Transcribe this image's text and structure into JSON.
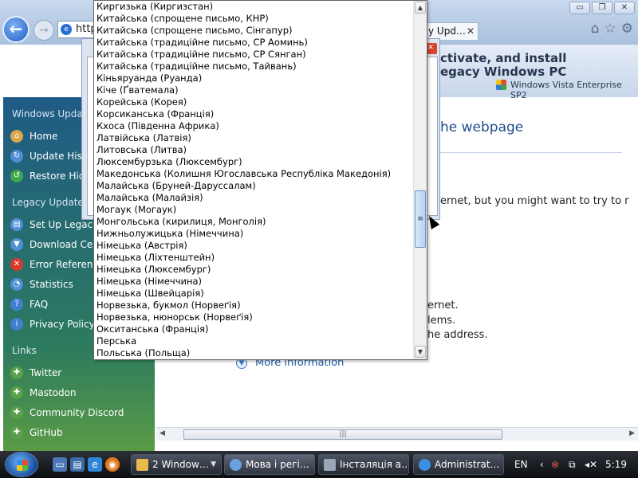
{
  "browser": {
    "address_prefix": "http",
    "tab_label": "y Upd…",
    "tab_close": "✕",
    "window_buttons": [
      "▭",
      "❐",
      "✕"
    ],
    "toolbar_icons": [
      "⌂",
      "☆",
      "⚙"
    ]
  },
  "page": {
    "banner_title_lines": [
      "ctivate, and install",
      "egacy Windows PC"
    ],
    "banner_subtitle": "Windows Vista Enterprise SP2",
    "heading": "he webpage",
    "body_line1": "ernet, but you might want to try to r",
    "body_lines": [
      "ernet.",
      "lems.",
      "he address."
    ],
    "more_info": "More information",
    "sidebar": {
      "section1": "Windows Updat",
      "items1": [
        {
          "label": "Home",
          "color": "#d9a64a"
        },
        {
          "label": "Update Hist",
          "color": "#4f8fd6"
        },
        {
          "label": "Restore Hid",
          "color": "#3ea84a"
        }
      ],
      "section2": "Legacy Update",
      "items2": [
        {
          "label": "Set Up Legacy",
          "color": "#4f8fd6"
        },
        {
          "label": "Download Cent",
          "color": "#4f8fd6"
        },
        {
          "label": "Error Reference",
          "color": "#d93a2c"
        },
        {
          "label": "Statistics",
          "color": "#4f8fd6"
        },
        {
          "label": "FAQ",
          "color": "#3e7fd0"
        },
        {
          "label": "Privacy Policy",
          "color": "#3e7fd0"
        }
      ],
      "section3": "Links",
      "items3": [
        {
          "label": "Twitter",
          "color": "#5aa04a"
        },
        {
          "label": "Mastodon",
          "color": "#5aa04a"
        },
        {
          "label": "Community Discord",
          "color": "#5aa04a"
        },
        {
          "label": "GitHub",
          "color": "#5aa04a"
        }
      ]
    }
  },
  "dropdown": {
    "items": [
      "Киргизька (Киргизстан)",
      "Китайська (спрощене письмо, КНР)",
      "Китайська (спрощене письмо, Сінгапур)",
      "Китайська (традиційне письмо, СР Аоминь)",
      "Китайська (традиційне письмо, СР Сянган)",
      "Китайська (традиційне письмо, Тайвань)",
      "Кіньяруанда (Руанда)",
      "Кіче (Ґватемала)",
      "Корейська (Корея)",
      "Корсиканська (Франція)",
      "Кхоса (Південна Африка)",
      "Латвійська (Латвія)",
      "Литовська (Литва)",
      "Люксембурзька (Люксембург)",
      "Македонська (Колишня Югославська Республіка Македонія)",
      "Малайська (Бруней-Даруссалам)",
      "Малайська (Малайзія)",
      "Могаук (Могаук)",
      "Монгольська (кирилиця, Монголія)",
      "Нижньолужицька (Німеччина)",
      "Німецька (Австрія)",
      "Німецька (Ліхтенштейн)",
      "Німецька (Люксембург)",
      "Німецька (Німеччина)",
      "Німецька (Швейцарія)",
      "Норвезька, букмол (Норвеґія)",
      "Норвезька, нюнорськ (Норвеґія)",
      "Окситанська (Франція)",
      "Перська",
      "Польська (Польща)"
    ]
  },
  "taskbar": {
    "tasks": [
      {
        "label": "2 Window…",
        "color": "#e9b949"
      },
      {
        "label": "Мова і регі…",
        "color": "#6aa0e0"
      },
      {
        "label": "Інсталяція а…",
        "color": "#9aa7ba"
      },
      {
        "label": "Administrat…",
        "color": "#3b8fe0"
      }
    ],
    "language": "EN",
    "time": "5:19"
  }
}
